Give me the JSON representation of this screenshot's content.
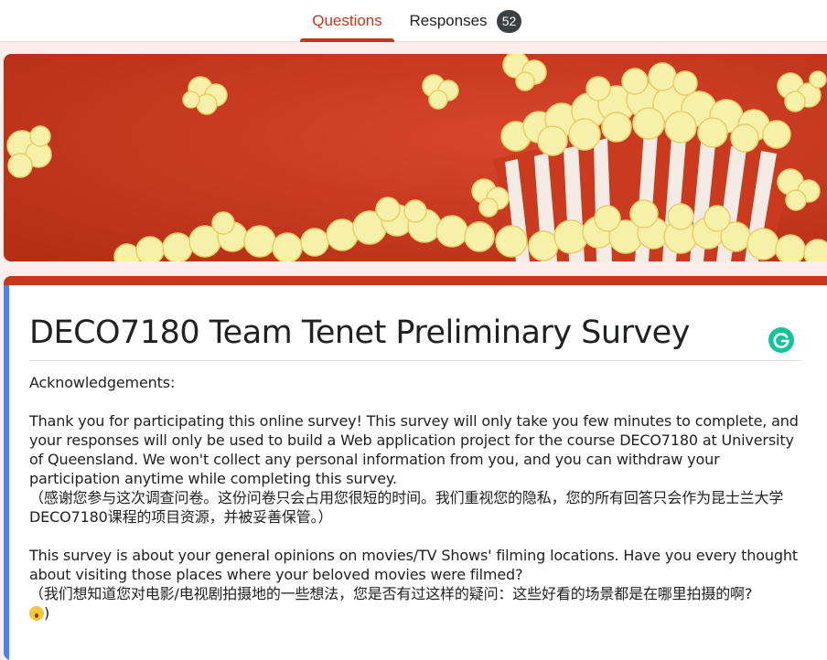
{
  "tabs": {
    "questions": "Questions",
    "responses": "Responses",
    "responses_count": "52"
  },
  "colors": {
    "accent": "#c5361a",
    "left_rail": "#4285f4",
    "banner_bg": "#c8371b",
    "popcorn": "#f6f0a8"
  },
  "banner": {
    "theme": "popcorn-box"
  },
  "form": {
    "title": "DECO7180 Team Tenet Preliminary Survey",
    "grammarly_icon": "grammarly-icon",
    "description": {
      "heading": "Acknowledgements:",
      "para1": "Thank you for participating this online survey! This survey will only take you few minutes to complete, and your responses will only be used to build a Web application project for the course DECO7180 at University of Queensland. We won't collect any personal information from you, and you can withdraw your participation anytime while completing this survey.",
      "para1_cn": "（感谢您参与这次调查问卷。这份问卷只会占用您很短的时间。我们重视您的隐私，您的所有回答只会作为昆士兰大学DECO7180课程的项目资源，并被妥善保管。）",
      "para2": "This survey is about your general opinions on movies/TV Shows' filming locations. Have you every thought about visiting those places where your beloved movies were filmed?",
      "para2_cn": "（我们想知道您对电影/电视剧拍摄地的一些想法，您是否有过这样的疑问：这些好看的场景都是在哪里拍摄的啊?",
      "para2_cn_end": ")"
    }
  }
}
